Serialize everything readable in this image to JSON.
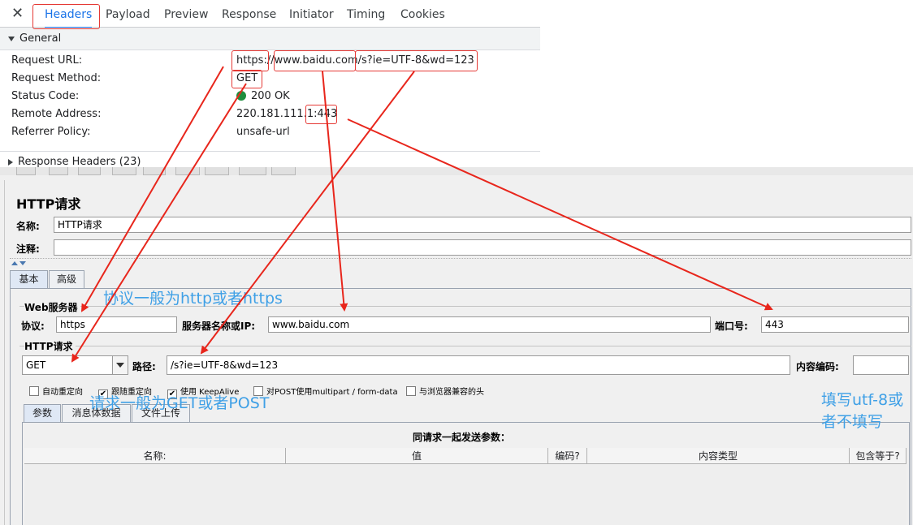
{
  "devtools": {
    "close_label": "✕",
    "tabs": [
      "Headers",
      "Payload",
      "Preview",
      "Response",
      "Initiator",
      "Timing",
      "Cookies"
    ],
    "general": {
      "title": "General",
      "rows": [
        {
          "label": "Request URL:",
          "value": "https://www.baidu.com/s?ie=UTF-8&wd=123"
        },
        {
          "label": "Request Method:",
          "value": "GET"
        },
        {
          "label": "Status Code:",
          "value": "200 OK"
        },
        {
          "label": "Remote Address:",
          "value": "220.181.111.1:443"
        },
        {
          "label": "Referrer Policy:",
          "value": "unsafe-url"
        }
      ]
    },
    "response_headers_title": "Response Headers (23)",
    "status_color": "#1e8e3e"
  },
  "jmeter": {
    "panel_title": "HTTP请求",
    "name_label": "名称:",
    "name_value": "HTTP请求",
    "comment_label": "注释:",
    "comment_value": "",
    "tabs": [
      "基本",
      "高级"
    ],
    "web_server": {
      "legend": "Web服务器",
      "protocol_label": "协议:",
      "protocol_value": "https",
      "server_label": "服务器名称或IP:",
      "server_value": "www.baidu.com",
      "port_label": "端口号:",
      "port_value": "443"
    },
    "http_request": {
      "legend": "HTTP请求",
      "method_value": "GET",
      "path_label": "路径:",
      "path_value": "/s?ie=UTF-8&wd=123",
      "encoding_label": "内容编码:",
      "encoding_value": ""
    },
    "checkboxes": [
      {
        "label": "自动重定向",
        "checked": false
      },
      {
        "label": "跟随重定向",
        "checked": true
      },
      {
        "label": "使用 KeepAlive",
        "checked": true
      },
      {
        "label": "对POST使用multipart / form-data",
        "checked": false
      },
      {
        "label": "与浏览器兼容的头",
        "checked": false
      }
    ],
    "sub_tabs": [
      "参数",
      "消息体数据",
      "文件上传"
    ],
    "params_caption": "同请求一起发送参数：",
    "columns": [
      "名称:",
      "值",
      "编码?",
      "内容类型",
      "包含等于?"
    ]
  },
  "annotations": {
    "protocol_note": "协议一般为http或者https",
    "method_note": "请求一般为GET或者POST",
    "encoding_note_line1": "填写utf-8或",
    "encoding_note_line2": "者不填写",
    "color": "#3fa0e6",
    "arrow_color": "#e8261c"
  }
}
